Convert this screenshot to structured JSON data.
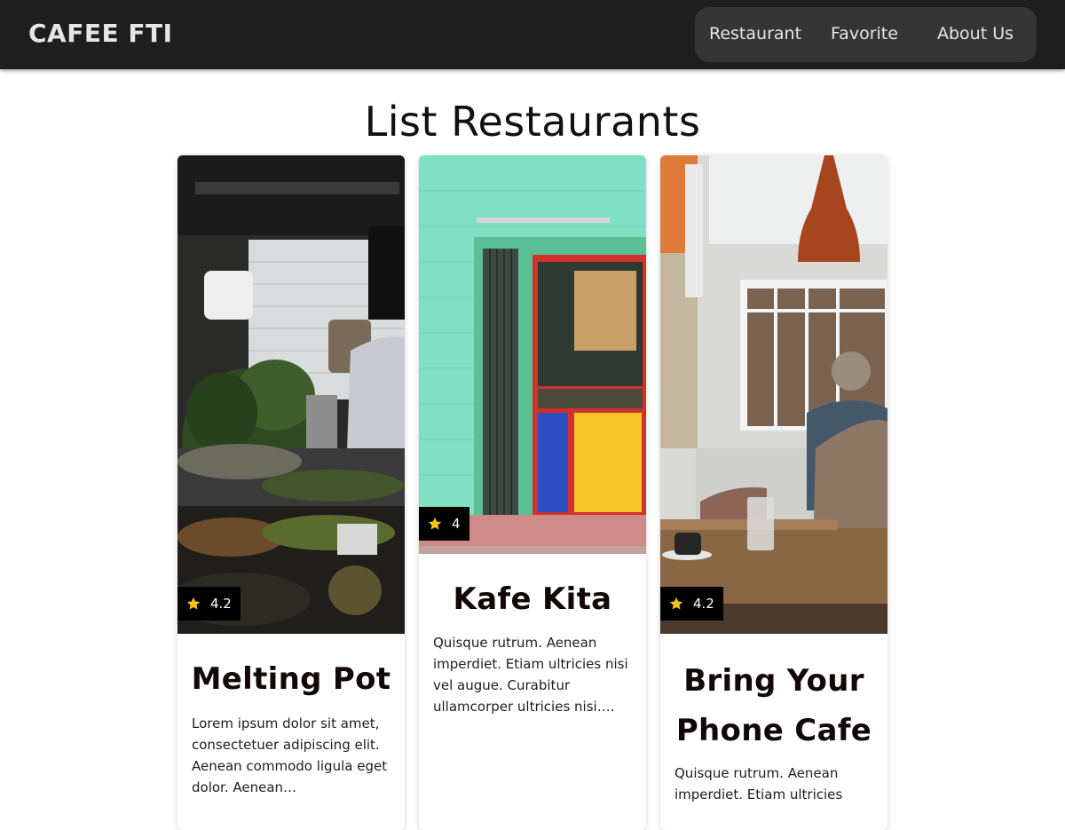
{
  "header": {
    "brand": "CAFEE FTI",
    "nav": [
      {
        "label": "Restaurant"
      },
      {
        "label": "Favorite"
      },
      {
        "label": "About Us"
      }
    ]
  },
  "main": {
    "title": "List Restaurants",
    "restaurants": [
      {
        "name": "Melting Pot",
        "rating": "4.2",
        "description": "Lorem ipsum dolor sit amet, consectetuer adipiscing elit. Aenean commodo ligula eget dolor. Aenean…"
      },
      {
        "name": "Kafe Kita",
        "rating": "4",
        "description": "Quisque rutrum. Aenean imperdiet. Etiam ultricies nisi vel augue. Curabitur ullamcorper ultricies nisi…."
      },
      {
        "name": "Bring Your Phone Cafe",
        "rating": "4.2",
        "description": "Quisque rutrum. Aenean imperdiet. Etiam ultricies"
      }
    ]
  },
  "icons": {
    "rating": "star-icon"
  },
  "colors": {
    "header_bg": "#1f1e1f",
    "nav_bg": "#363536",
    "star": "#f5c518",
    "rating_badge": "#000000"
  }
}
